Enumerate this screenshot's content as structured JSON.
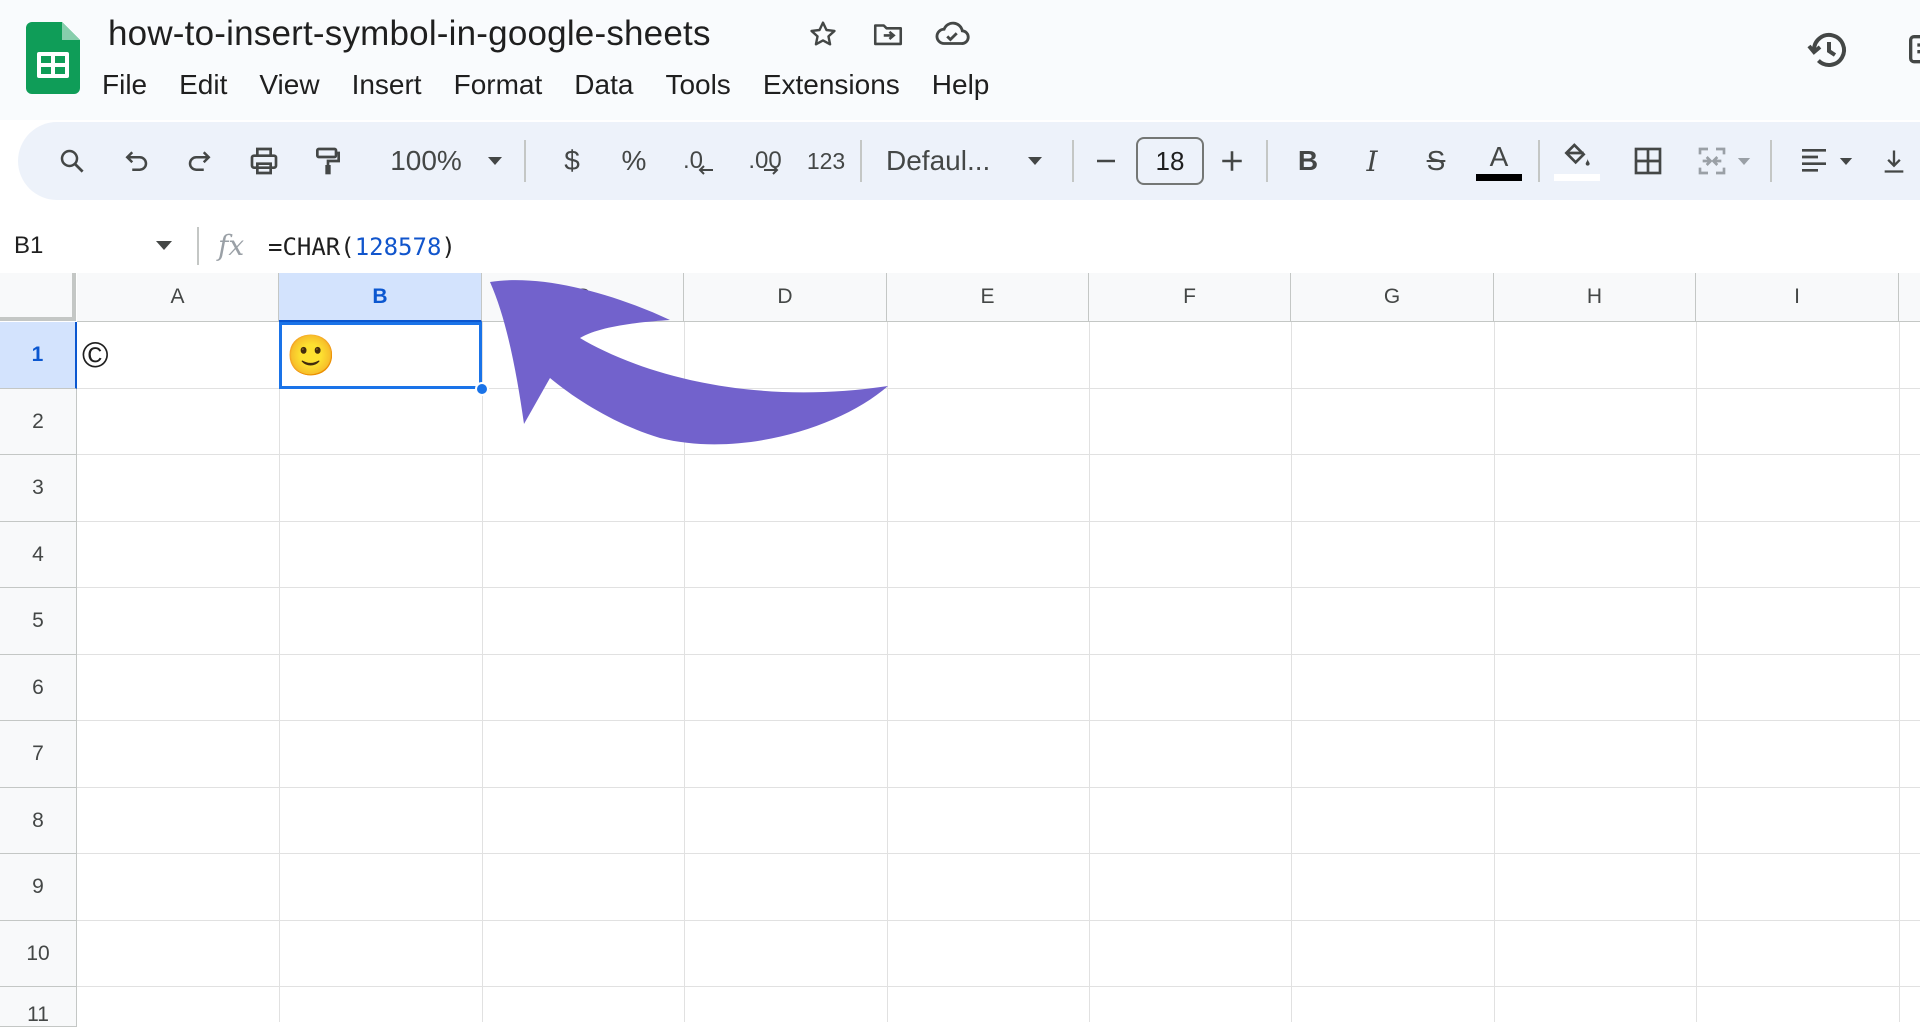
{
  "header": {
    "doc_title": "how-to-insert-symbol-in-google-sheets",
    "menu": [
      "File",
      "Edit",
      "View",
      "Insert",
      "Format",
      "Data",
      "Tools",
      "Extensions",
      "Help"
    ]
  },
  "toolbar": {
    "zoom": "100%",
    "currency_label": "$",
    "percent_label": "%",
    "decrease_decimal_label": ".0",
    "increase_decimal_label": ".00",
    "number_format_label": "123",
    "font_name": "Defaul...",
    "font_size": "18",
    "bold_label": "B",
    "italic_label": "I",
    "strikethrough_label": "S",
    "text_color_label": "A",
    "text_color": "#000000"
  },
  "formula_bar": {
    "cell_ref": "B1",
    "fx": "fx",
    "formula_prefix": "=CHAR(",
    "formula_number": "128578",
    "formula_suffix": ")"
  },
  "grid": {
    "columns": [
      "A",
      "B",
      "C",
      "D",
      "E",
      "F",
      "G",
      "H",
      "I"
    ],
    "rows": [
      "1",
      "2",
      "3",
      "4",
      "5",
      "6",
      "7",
      "8",
      "9",
      "10",
      "11"
    ],
    "selected_cell": "B1",
    "cells": {
      "A1": "©",
      "B1": "🙂"
    }
  },
  "colors": {
    "sheets_green": "#0f9d58",
    "selection_blue": "#1a73e8",
    "arrow_purple": "#7262cc",
    "toolbar_bg": "#edf2fa"
  },
  "icons": {
    "logo": "google-sheets-logo",
    "star": "star-icon",
    "move": "move-to-folder-icon",
    "cloud": "cloud-saved-icon",
    "history": "version-history-icon"
  }
}
